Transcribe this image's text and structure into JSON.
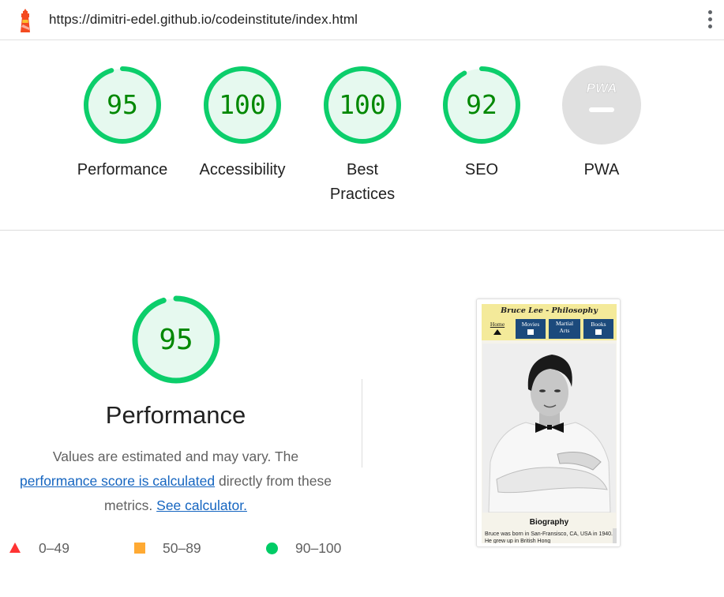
{
  "browser": {
    "url": "https://dimitri-edel.github.io/codeinstitute/index.html",
    "logo_icon": "lighthouse-icon",
    "menu_icon": "more-vert-icon"
  },
  "categories": [
    {
      "score": "95",
      "label": "Performance",
      "fill": 0.95
    },
    {
      "score": "100",
      "label": "Accessibility",
      "fill": 1.0
    },
    {
      "score": "100",
      "label": "Best Practices",
      "fill": 1.0
    },
    {
      "score": "92",
      "label": "SEO",
      "fill": 0.92
    },
    {
      "score": "PWA",
      "label": "PWA",
      "fill": 0
    }
  ],
  "performance": {
    "score": "95",
    "fill": 0.95,
    "title": "Performance",
    "desc_1": "Values are estimated and may vary. The",
    "desc_link_1": "performance score is calculated",
    "desc_2": " directly from these metrics. ",
    "desc_link_2": "See calculator."
  },
  "legend": [
    {
      "range": "0–49",
      "shape": "triangle",
      "color": "#ff3333"
    },
    {
      "range": "50–89",
      "shape": "square",
      "color": "#ffaa33"
    },
    {
      "range": "90–100",
      "shape": "circle",
      "color": "#00cc66"
    }
  ],
  "colors": {
    "pass_ring": "#0cce6b",
    "pass_fill": "#e6f9ef",
    "pass_text": "#008800",
    "pwa_gray": "#e0e0e0"
  },
  "screenshot": {
    "site_title": "Bruce Lee - Philosophy",
    "nav": [
      {
        "label": "Home",
        "icon": "home-icon"
      },
      {
        "label": "Movies",
        "icon": "film-icon"
      },
      {
        "label": "Martial Arts",
        "icon": "fist-icon"
      },
      {
        "label": "Books",
        "icon": "book-icon"
      }
    ],
    "section_heading": "Biography",
    "bio_text": "Bruce was born in San-Fransisco, CA, USA in 1940. He grew up in British Hong"
  }
}
